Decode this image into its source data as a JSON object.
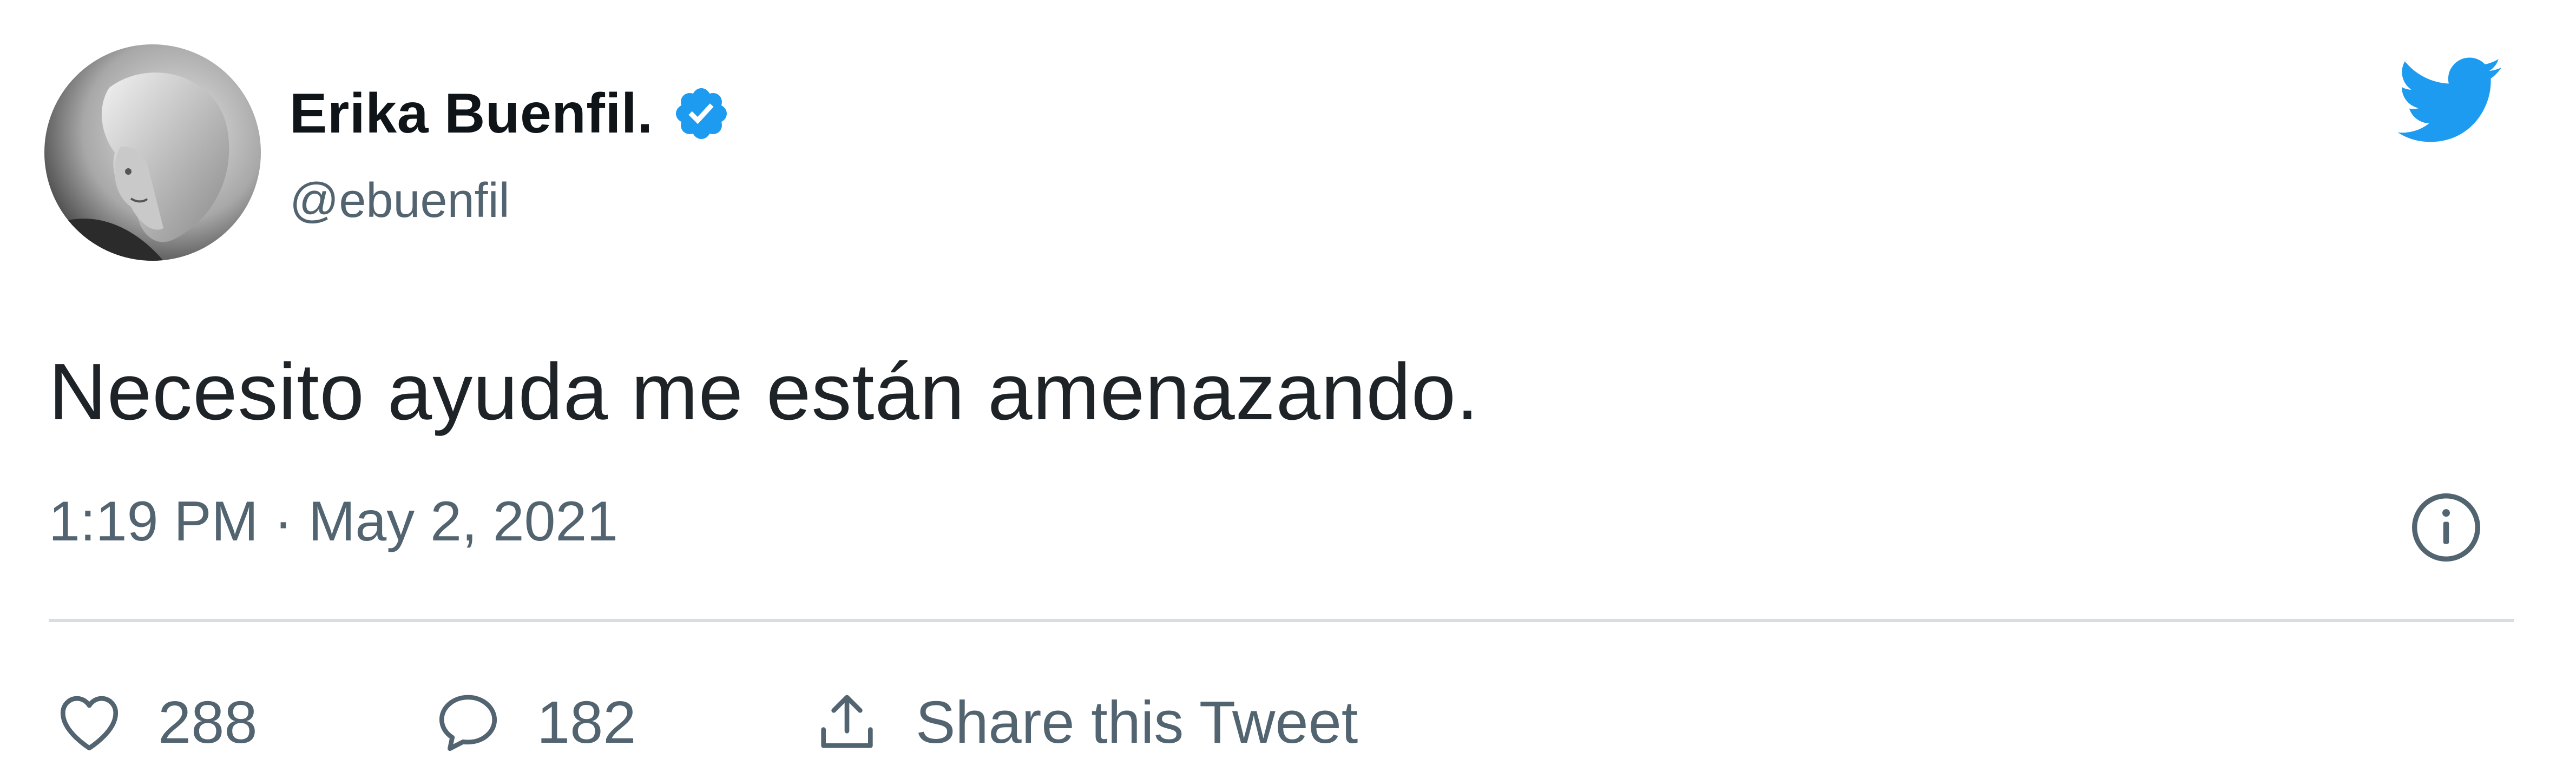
{
  "author": {
    "display_name": "Erika Buenfil.",
    "handle": "@ebuenfil",
    "verified": true,
    "avatar_icon": "avatar-photo"
  },
  "tweet": {
    "text": "Necesito ayuda me están amenazando.",
    "timestamp": "1:19 PM · May 2, 2021"
  },
  "actions": {
    "like": {
      "icon": "heart-icon",
      "count": "288"
    },
    "reply": {
      "icon": "reply-bubble-icon",
      "count": "182"
    },
    "share": {
      "icon": "share-icon",
      "label": "Share this Tweet"
    }
  },
  "icons": {
    "brand": "twitter-bird-icon",
    "verified": "verified-badge-icon",
    "info": "info-icon"
  },
  "colors": {
    "brand_blue": "#1d9bf0",
    "text_primary": "#0f1419",
    "text_secondary": "#536471",
    "divider": "#d7dde2"
  }
}
